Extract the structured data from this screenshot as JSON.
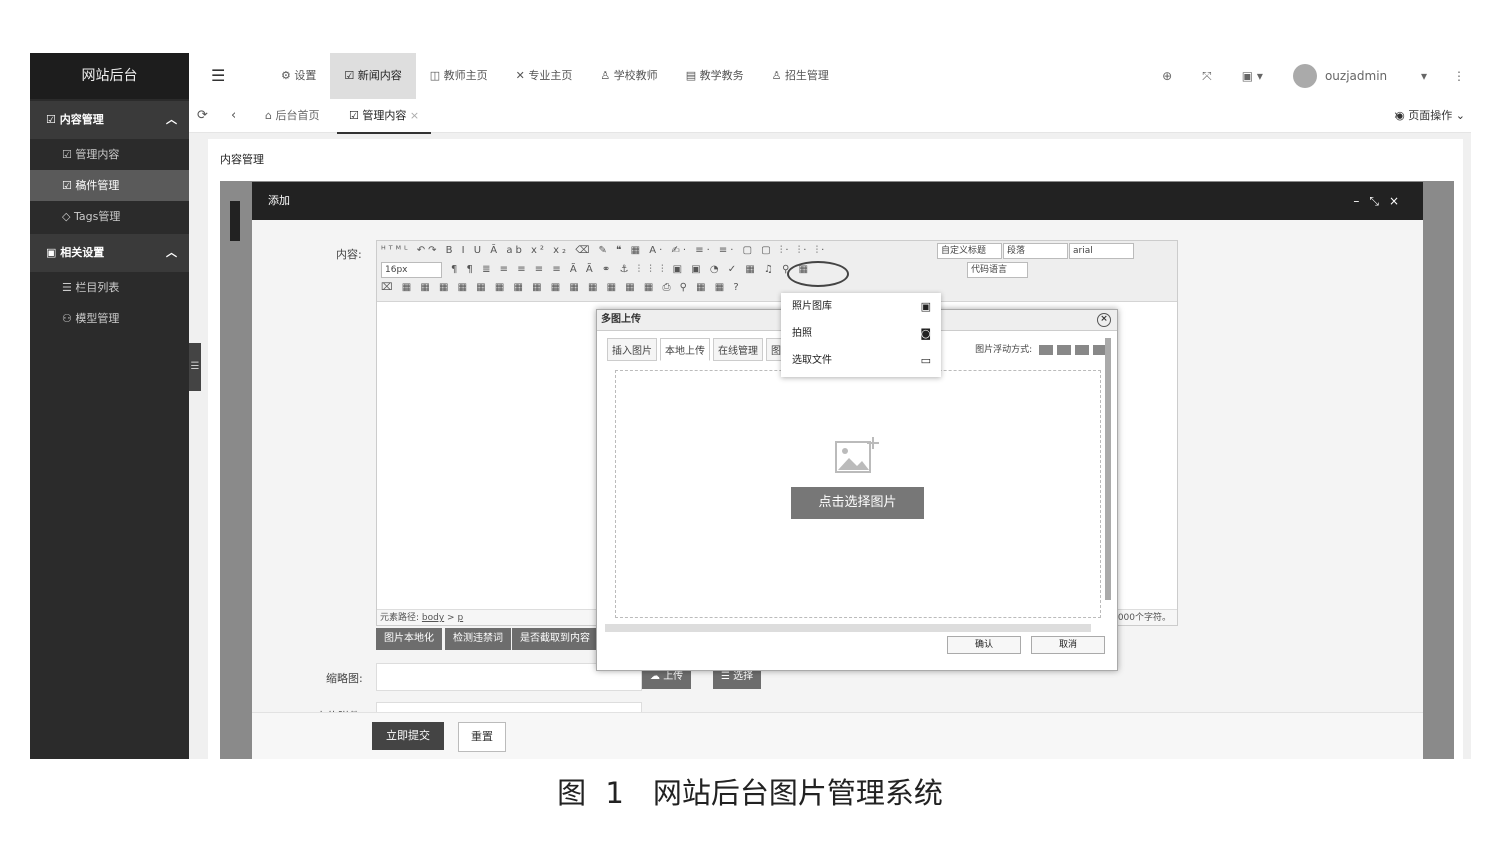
{
  "sidebar": {
    "brand": "网站后台",
    "sections": [
      {
        "title": "内容管理",
        "items": [
          "管理内容",
          "稿件管理",
          "Tags管理"
        ]
      },
      {
        "title": "相关设置",
        "items": [
          "栏目列表",
          "模型管理"
        ]
      }
    ]
  },
  "topnav": {
    "items": [
      "设置",
      "新闻内容",
      "教师主页",
      "专业主页",
      "学校教师",
      "教学教务",
      "招生管理"
    ],
    "user": "ouzjadmin"
  },
  "tabs": {
    "home": "后台首页",
    "current": "管理内容",
    "page_ops": "页面操作"
  },
  "content": {
    "breadcrumb": "内容管理"
  },
  "dialog": {
    "title": "添加",
    "content_label": "内容:",
    "editor": {
      "font_size": "16px",
      "heading_select": "自定义标题",
      "paragraph_select": "段落",
      "font_select": "arial",
      "code_select": "代码语言",
      "path_label": "元素路径:",
      "path_body": "body",
      "path_p": "p",
      "char_count": "000个字符。"
    },
    "buttons": [
      "图片本地化",
      "检测违禁词",
      "是否截取到内容"
    ],
    "thumb_label": "缩略图:",
    "upload_label": "上传",
    "choose_label": "选择",
    "attach_label": "上传附件:",
    "submit": "立即提交",
    "reset": "重置"
  },
  "upload_modal": {
    "title": "多图上传",
    "tabs": [
      "插入图片",
      "本地上传",
      "在线管理",
      "图片"
    ],
    "float_label": "图片浮动方式:",
    "pick_button": "点击选择图片",
    "confirm": "确认",
    "cancel": "取消"
  },
  "dropdown": {
    "items": [
      {
        "label": "照片图库",
        "icon": "gallery-icon"
      },
      {
        "label": "拍照",
        "icon": "camera-icon"
      },
      {
        "label": "选取文件",
        "icon": "folder-icon"
      }
    ]
  },
  "caption": "图 1　网站后台图片管理系统"
}
